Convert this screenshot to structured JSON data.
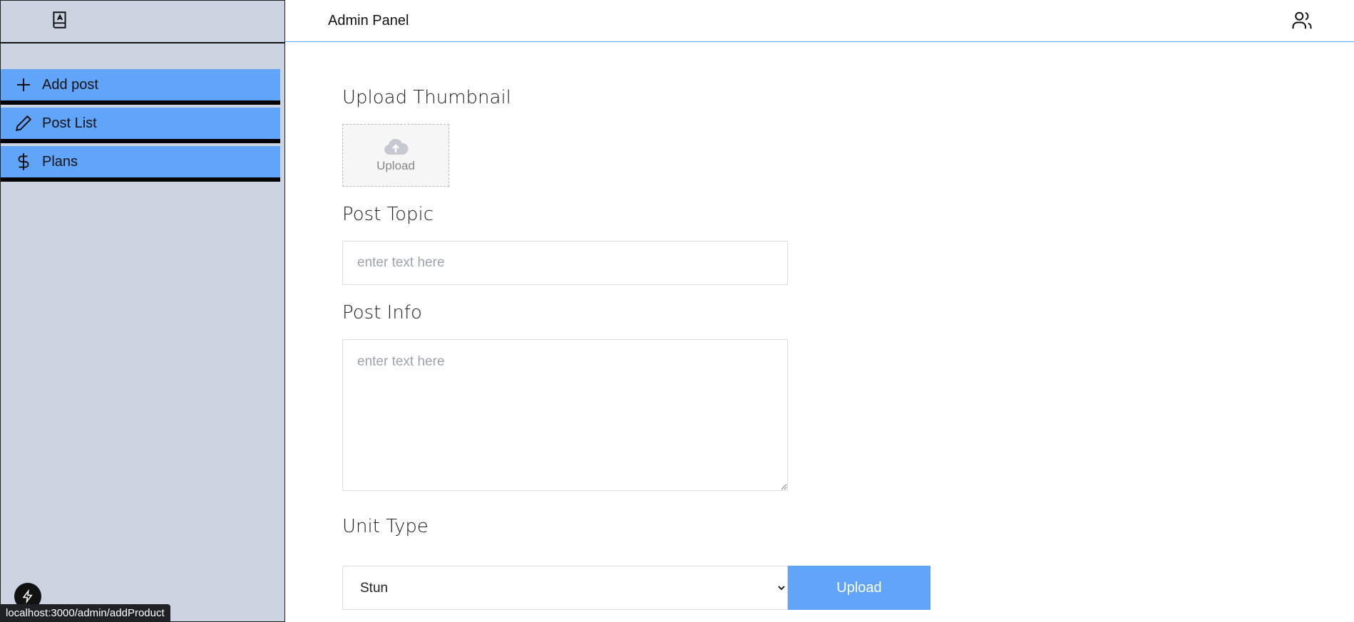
{
  "topbar": {
    "title": "Admin Panel"
  },
  "sidebar": {
    "items": [
      {
        "label": "Add post",
        "icon": "plus-icon"
      },
      {
        "label": "Post List",
        "icon": "pencil-icon"
      },
      {
        "label": "Plans",
        "icon": "dollar-icon"
      }
    ]
  },
  "form": {
    "thumbnail_label": "Upload Thumbnail",
    "thumbnail_upload_text": "Upload",
    "topic_label": "Post Topic",
    "topic_placeholder": "enter text here",
    "info_label": "Post Info",
    "info_placeholder": "enter text here",
    "unit_label": "Unit Type",
    "unit_selected": "Stun",
    "upload_button": "Upload"
  },
  "status": {
    "url": "localhost:3000/admin/addProduct"
  },
  "colors": {
    "accent": "#60a5fa",
    "sidebar_bg": "#cad3df"
  }
}
